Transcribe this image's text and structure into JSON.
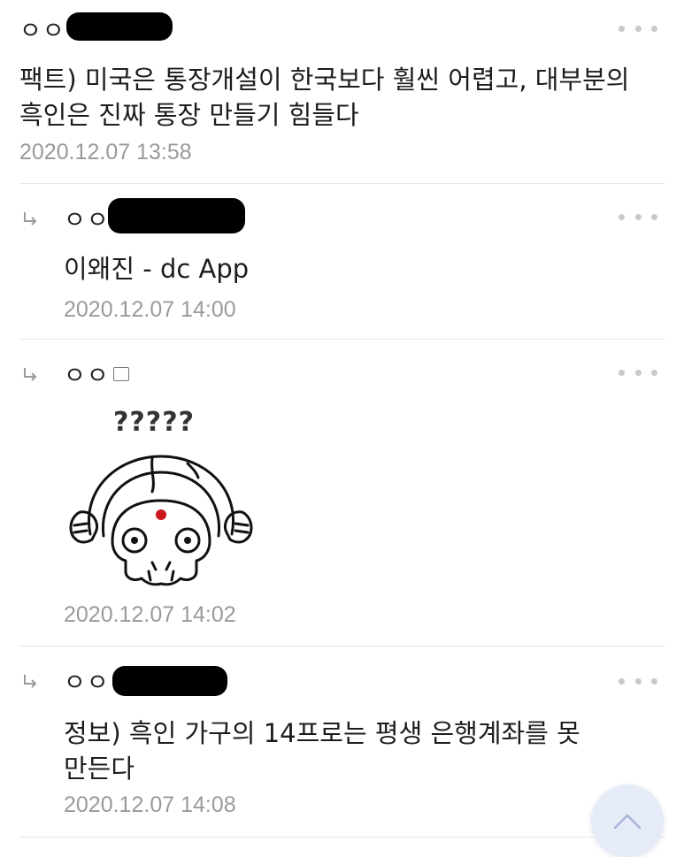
{
  "comments": [
    {
      "nickname": "ㅇㅇ",
      "body": "팩트) 미국은 통장개설이 한국보다 훨씬 어렵고, 대부분의\n흑인은 진짜 통장 만들기 힘들다",
      "timestamp": "2020.12.07 13:58"
    },
    {
      "nickname": "ㅇㅇ",
      "body": "이왜진 - dc App",
      "timestamp": "2020.12.07 14:00"
    },
    {
      "nickname": "ㅇㅇ",
      "sticker_caption": "?????",
      "timestamp": "2020.12.07 14:02"
    },
    {
      "nickname": "ㅇㅇ",
      "body": "정보) 흑인 가구의 14프로는 평생 은행계좌를 못\n만든다",
      "timestamp": "2020.12.07 14:08"
    }
  ],
  "icons": {
    "more": "more-dots-icon",
    "reply": "reply-arrow-icon",
    "scroll_top": "chevron-up-icon",
    "fixed_nick": "fixed-nickname-icon"
  },
  "colors": {
    "timestamp": "#9a9a9a",
    "more_dots": "#c9c9c9",
    "scroll_button": "#e6ebf8"
  }
}
